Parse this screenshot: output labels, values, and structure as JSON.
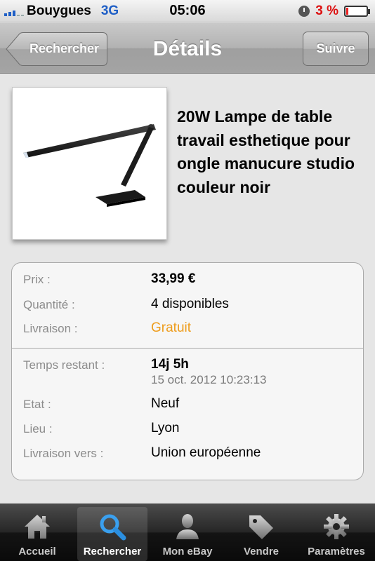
{
  "status_bar": {
    "carrier": "Bouygues",
    "network": "3G",
    "time": "05:06",
    "battery": "3 %",
    "battery_level": 0.03
  },
  "nav": {
    "back_label": "Rechercher",
    "title": "Détails",
    "follow_label": "Suivre"
  },
  "product": {
    "title": "20W Lampe de table travail esthetique pour ongle manucure studio couleur noir",
    "image_icon": "desk-lamp-photo"
  },
  "details": {
    "price_label": "Prix :",
    "price": "33,99 €",
    "quantity_label": "Quantité :",
    "quantity": "4 disponibles",
    "shipping_label": "Livraison :",
    "shipping": "Gratuit",
    "time_left_label": "Temps restant :",
    "time_left": "14j 5h",
    "end_date": "15 oct. 2012 10:23:13",
    "condition_label": "Etat :",
    "condition": "Neuf",
    "location_label": "Lieu :",
    "location": "Lyon",
    "ships_to_label": "Livraison vers :",
    "ships_to": "Union européenne"
  },
  "colors": {
    "shipping_free": "#ee9c1b",
    "active_tab_icon": "#2b8fe0"
  },
  "tabs": [
    {
      "label": "Accueil",
      "icon": "home-icon",
      "active": false
    },
    {
      "label": "Rechercher",
      "icon": "search-icon",
      "active": true
    },
    {
      "label": "Mon eBay",
      "icon": "person-icon",
      "active": false
    },
    {
      "label": "Vendre",
      "icon": "tag-icon",
      "active": false
    },
    {
      "label": "Paramètres",
      "icon": "gear-icon",
      "active": false
    }
  ]
}
